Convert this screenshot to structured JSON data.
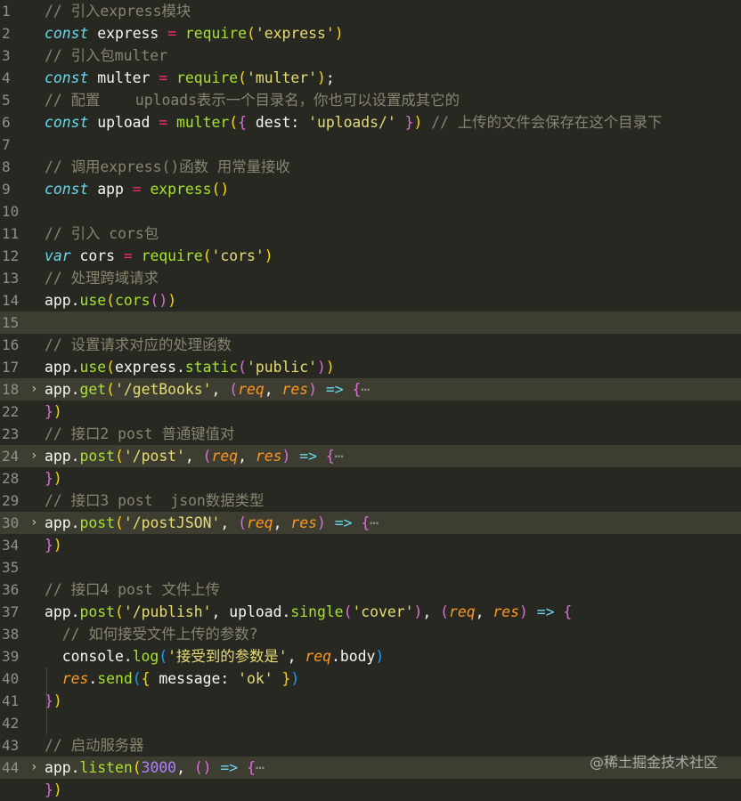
{
  "editor": {
    "lines": [
      {
        "n": "1",
        "t": [
          [
            "c",
            "// 引入express模块"
          ]
        ]
      },
      {
        "n": "2",
        "t": [
          [
            "k",
            "const"
          ],
          [
            "w",
            " "
          ],
          [
            "w",
            "express"
          ],
          [
            "w",
            " "
          ],
          [
            "o",
            "="
          ],
          [
            "w",
            " "
          ],
          [
            "fn",
            "require"
          ],
          [
            "b1",
            "("
          ],
          [
            "s",
            "'express'"
          ],
          [
            "b1",
            ")"
          ]
        ]
      },
      {
        "n": "3",
        "t": [
          [
            "c",
            "// 引入包multer"
          ]
        ]
      },
      {
        "n": "4",
        "t": [
          [
            "k",
            "const"
          ],
          [
            "w",
            " multer "
          ],
          [
            "o",
            "="
          ],
          [
            "w",
            " "
          ],
          [
            "fn",
            "require"
          ],
          [
            "b1",
            "("
          ],
          [
            "s",
            "'multer'"
          ],
          [
            "b1",
            ")"
          ],
          [
            "w",
            ";"
          ]
        ]
      },
      {
        "n": "5",
        "t": [
          [
            "c",
            "// 配置    uploads表示一个目录名，你也可以设置成其它的"
          ]
        ]
      },
      {
        "n": "6",
        "t": [
          [
            "k",
            "const"
          ],
          [
            "w",
            " upload "
          ],
          [
            "o",
            "="
          ],
          [
            "w",
            " "
          ],
          [
            "fn",
            "multer"
          ],
          [
            "b1",
            "("
          ],
          [
            "b2",
            "{"
          ],
          [
            "w",
            " dest: "
          ],
          [
            "s",
            "'uploads/'"
          ],
          [
            "w",
            " "
          ],
          [
            "b2",
            "}"
          ],
          [
            "b1",
            ")"
          ],
          [
            "w",
            " "
          ],
          [
            "c",
            "// 上传的文件会保存在这个目录下"
          ]
        ]
      },
      {
        "n": "7",
        "t": []
      },
      {
        "n": "8",
        "t": [
          [
            "c",
            "// 调用express()函数 用常量接收"
          ]
        ]
      },
      {
        "n": "9",
        "t": [
          [
            "k",
            "const"
          ],
          [
            "w",
            " app "
          ],
          [
            "o",
            "="
          ],
          [
            "w",
            " "
          ],
          [
            "fn",
            "express"
          ],
          [
            "b1",
            "()"
          ]
        ]
      },
      {
        "n": "10",
        "t": []
      },
      {
        "n": "11",
        "t": [
          [
            "c",
            "// 引入 cors包"
          ]
        ]
      },
      {
        "n": "12",
        "t": [
          [
            "k",
            "var"
          ],
          [
            "w",
            " cors "
          ],
          [
            "o",
            "="
          ],
          [
            "w",
            " "
          ],
          [
            "fn",
            "require"
          ],
          [
            "b1",
            "("
          ],
          [
            "s",
            "'cors'"
          ],
          [
            "b1",
            ")"
          ]
        ]
      },
      {
        "n": "13",
        "t": [
          [
            "c",
            "// 处理跨域请求"
          ]
        ]
      },
      {
        "n": "14",
        "t": [
          [
            "w",
            "app."
          ],
          [
            "fn",
            "use"
          ],
          [
            "b1",
            "("
          ],
          [
            "fn",
            "cors"
          ],
          [
            "b2",
            "()"
          ],
          [
            "b1",
            ")"
          ]
        ]
      },
      {
        "n": "15",
        "t": [],
        "cur": true
      },
      {
        "n": "16",
        "t": [
          [
            "c",
            "// 设置请求对应的处理函数"
          ]
        ]
      },
      {
        "n": "17",
        "t": [
          [
            "w",
            "app."
          ],
          [
            "fn",
            "use"
          ],
          [
            "b1",
            "("
          ],
          [
            "w",
            "express."
          ],
          [
            "fn",
            "static"
          ],
          [
            "b2",
            "("
          ],
          [
            "s",
            "'public'"
          ],
          [
            "b2",
            ")"
          ],
          [
            "b1",
            ")"
          ]
        ]
      },
      {
        "n": "18",
        "fold": true,
        "hl": true,
        "t": [
          [
            "w",
            "app."
          ],
          [
            "fn",
            "get"
          ],
          [
            "b1",
            "("
          ],
          [
            "s",
            "'/getBooks'"
          ],
          [
            "w",
            ", "
          ],
          [
            "b2",
            "("
          ],
          [
            "p",
            "req"
          ],
          [
            "w",
            ", "
          ],
          [
            "p",
            "res"
          ],
          [
            "b2",
            ")"
          ],
          [
            "w",
            " "
          ],
          [
            "k",
            "=>"
          ],
          [
            "w",
            " "
          ],
          [
            "b2",
            "{"
          ],
          [
            "ell",
            "⋯"
          ]
        ]
      },
      {
        "n": "22",
        "t": [
          [
            "b2",
            "}"
          ],
          [
            "b1",
            ")"
          ]
        ]
      },
      {
        "n": "23",
        "t": [
          [
            "c",
            "// 接口2 post 普通键值对"
          ]
        ]
      },
      {
        "n": "24",
        "fold": true,
        "hl": true,
        "t": [
          [
            "w",
            "app."
          ],
          [
            "fn",
            "post"
          ],
          [
            "b1",
            "("
          ],
          [
            "s",
            "'/post'"
          ],
          [
            "w",
            ", "
          ],
          [
            "b2",
            "("
          ],
          [
            "p",
            "req"
          ],
          [
            "w",
            ", "
          ],
          [
            "p",
            "res"
          ],
          [
            "b2",
            ")"
          ],
          [
            "w",
            " "
          ],
          [
            "k",
            "=>"
          ],
          [
            "w",
            " "
          ],
          [
            "b2",
            "{"
          ],
          [
            "ell",
            "⋯"
          ]
        ]
      },
      {
        "n": "28",
        "t": [
          [
            "b2",
            "}"
          ],
          [
            "b1",
            ")"
          ]
        ]
      },
      {
        "n": "29",
        "t": [
          [
            "c",
            "// 接口3 post  json数据类型"
          ]
        ]
      },
      {
        "n": "30",
        "fold": true,
        "hl": true,
        "t": [
          [
            "w",
            "app."
          ],
          [
            "fn",
            "post"
          ],
          [
            "b1",
            "("
          ],
          [
            "s",
            "'/postJSON'"
          ],
          [
            "w",
            ", "
          ],
          [
            "b2",
            "("
          ],
          [
            "p",
            "req"
          ],
          [
            "w",
            ", "
          ],
          [
            "p",
            "res"
          ],
          [
            "b2",
            ")"
          ],
          [
            "w",
            " "
          ],
          [
            "k",
            "=>"
          ],
          [
            "w",
            " "
          ],
          [
            "b2",
            "{"
          ],
          [
            "ell",
            "⋯"
          ]
        ]
      },
      {
        "n": "34",
        "t": [
          [
            "b2",
            "}"
          ],
          [
            "b1",
            ")"
          ]
        ]
      },
      {
        "n": "35",
        "t": []
      },
      {
        "n": "36",
        "t": [
          [
            "c",
            "// 接口4 post 文件上传"
          ]
        ]
      },
      {
        "n": "37",
        "t": [
          [
            "w",
            "app."
          ],
          [
            "fn",
            "post"
          ],
          [
            "b1",
            "("
          ],
          [
            "s",
            "'/publish'"
          ],
          [
            "w",
            ", upload."
          ],
          [
            "fn",
            "single"
          ],
          [
            "b2",
            "("
          ],
          [
            "s",
            "'cover'"
          ],
          [
            "b2",
            ")"
          ],
          [
            "w",
            ", "
          ],
          [
            "b2",
            "("
          ],
          [
            "p",
            "req"
          ],
          [
            "w",
            ", "
          ],
          [
            "p",
            "res"
          ],
          [
            "b2",
            ")"
          ],
          [
            "w",
            " "
          ],
          [
            "k",
            "=>"
          ],
          [
            "w",
            " "
          ],
          [
            "b2",
            "{"
          ]
        ]
      },
      {
        "n": "38",
        "t": [
          [
            "w",
            "  "
          ],
          [
            "c",
            "// 如何接受文件上传的参数?"
          ]
        ]
      },
      {
        "n": "39",
        "t": [
          [
            "w",
            "  console."
          ],
          [
            "fn",
            "log"
          ],
          [
            "b3",
            "("
          ],
          [
            "s",
            "'接受到的参数是'"
          ],
          [
            "w",
            ", "
          ],
          [
            "p",
            "req"
          ],
          [
            "w",
            ".body"
          ],
          [
            "b3",
            ")"
          ]
        ]
      },
      {
        "n": "40",
        "t": [
          [
            "w",
            "  "
          ],
          [
            "p",
            "res"
          ],
          [
            "w",
            "."
          ],
          [
            "fn",
            "send"
          ],
          [
            "b3",
            "("
          ],
          [
            "b1",
            "{"
          ],
          [
            "w",
            " message: "
          ],
          [
            "s",
            "'ok'"
          ],
          [
            "w",
            " "
          ],
          [
            "b1",
            "}"
          ],
          [
            "b3",
            ")"
          ]
        ]
      },
      {
        "n": "41",
        "t": [
          [
            "b2",
            "}"
          ],
          [
            "b1",
            ")"
          ]
        ]
      },
      {
        "n": "42",
        "t": []
      },
      {
        "n": "43",
        "t": [
          [
            "c",
            "// 启动服务器"
          ]
        ]
      },
      {
        "n": "44",
        "fold": true,
        "hl": true,
        "t": [
          [
            "w",
            "app."
          ],
          [
            "fn",
            "listen"
          ],
          [
            "b1",
            "("
          ],
          [
            "n",
            "3000"
          ],
          [
            "w",
            ", "
          ],
          [
            "b2",
            "()"
          ],
          [
            "w",
            " "
          ],
          [
            "k",
            "=>"
          ],
          [
            "w",
            " "
          ],
          [
            "b2",
            "{"
          ],
          [
            "ell",
            "⋯"
          ]
        ]
      },
      {
        "n": "",
        "t": [
          [
            "b2",
            "}"
          ],
          [
            "b1",
            ")"
          ]
        ]
      }
    ]
  },
  "watermark": "@稀土掘金技术社区",
  "icons": {
    "fold": "chevron-right-icon"
  },
  "colors": {
    "background": "#272822",
    "comment": "#88846f",
    "keyword": "#66d9ef",
    "function": "#a6e22e",
    "string": "#e6db74",
    "param": "#fd971f",
    "operator": "#f92672",
    "number": "#ae81ff"
  }
}
